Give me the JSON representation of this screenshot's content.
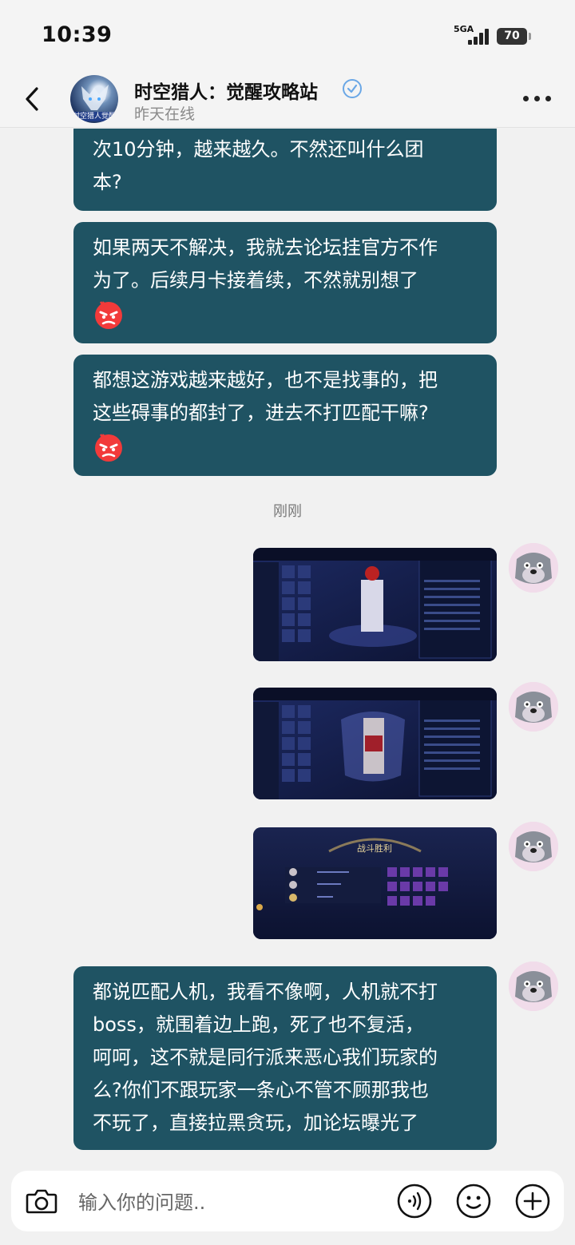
{
  "status_bar": {
    "time": "10:39",
    "network": "5GA",
    "battery": "70"
  },
  "header": {
    "title": "时空猎人：觉醒攻略站",
    "subtitle": "昨天在线",
    "avatar_tag": "时空猎人觉醒"
  },
  "messages": [
    {
      "lines": [
        "次10分钟，越来越久。不然还叫什么团",
        "本?"
      ]
    },
    {
      "lines": [
        "如果两天不解决，我就去论坛挂官方不作",
        "为了。后续月卡接着续，不然就别想了"
      ],
      "emoji": "angry-face"
    },
    {
      "lines": [
        "都想这游戏越来越好，也不是找事的，把",
        "这些碍事的都封了，进去不打匹配干嘛?"
      ],
      "emoji": "angry-face"
    },
    {
      "lines": [
        "都说匹配人机，我看不像啊，人机就不打",
        "boss，就围着边上跑，死了也不复活，",
        "呵呵，这不就是同行派来恶心我们玩家的",
        "么?你们不跟玩家一条心不管不顾那我也",
        "不玩了，直接拉黑贪玩，加论坛曝光了"
      ]
    }
  ],
  "timestamp": "刚刚",
  "image_messages": [
    {
      "kind": "character-stats-screenshot"
    },
    {
      "kind": "character-stats-screenshot"
    },
    {
      "kind": "battle-victory-screenshot",
      "banner": "战斗胜利"
    }
  ],
  "input": {
    "placeholder": "输入你的问题.."
  },
  "colors": {
    "bubble": "#1f5363",
    "background": "#f1f1f1",
    "verify": "#6aa7e6"
  }
}
